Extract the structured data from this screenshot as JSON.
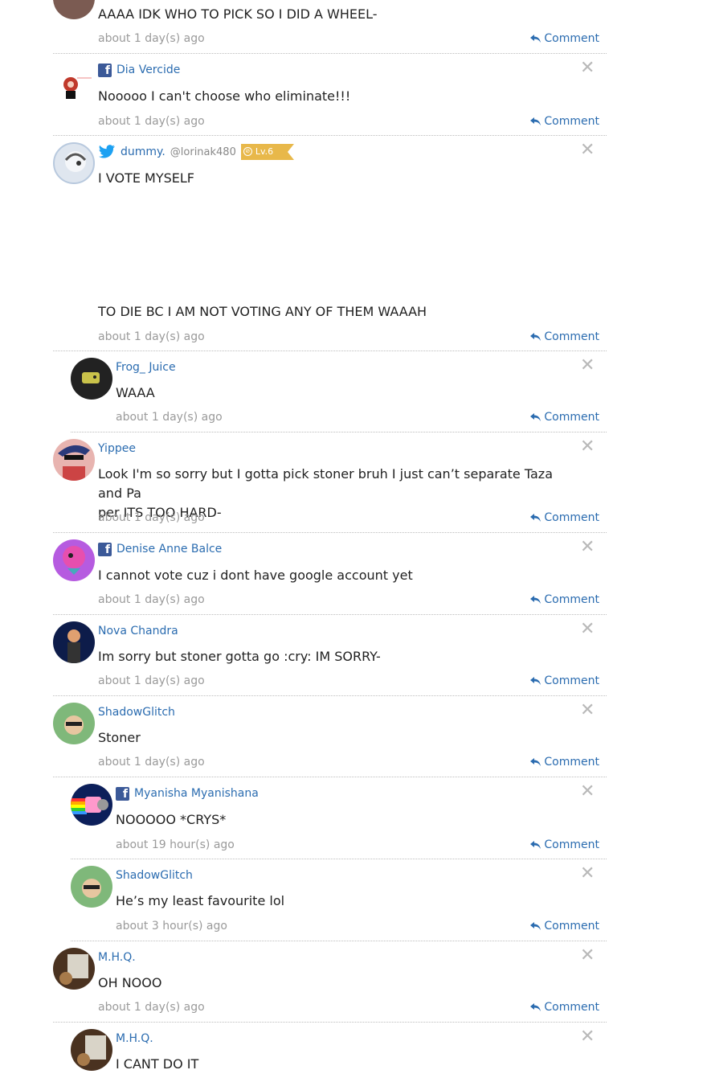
{
  "comment_action_label": "Comment",
  "comments": [
    {
      "author": "",
      "text": "AAAA IDK WHO TO PICK SO I DID A WHEEL-",
      "time": "about 1 day(s) ago"
    },
    {
      "author": "Dia Vercide",
      "source": "facebook",
      "text": "Nooooo I can't choose who eliminate!!!",
      "time": "about 1 day(s) ago"
    },
    {
      "author": "dummy.",
      "source": "twitter",
      "handle": "@lorinak480",
      "level": "Lv.6",
      "text": "I VOTE MYSELF",
      "text_cont": "TO DIE BC I AM NOT VOTING ANY OF THEM WAAAH",
      "time": "about 1 day(s) ago"
    },
    {
      "author": "Frog_ Juice",
      "text": "WAAA",
      "time": "about 1 day(s) ago"
    },
    {
      "author": "Yippee",
      "text": "Look I'm so sorry but I gotta pick stoner bruh I just can’t separate Taza and Pa\nper ITS TOO HARD-",
      "time": "about 1 day(s) ago"
    },
    {
      "author": "Denise Anne Balce",
      "source": "facebook",
      "text": "I cannot vote cuz i dont have google account yet",
      "time": "about 1 day(s) ago"
    },
    {
      "author": "Nova Chandra",
      "text": "Im sorry but stoner gotta go :cry: IM SORRY-",
      "time": "about 1 day(s) ago"
    },
    {
      "author": "ShadowGlitch",
      "text": "Stoner",
      "time": "about 1 day(s) ago"
    },
    {
      "author": "Myanisha Myanishana",
      "source": "facebook",
      "text": "NOOOOO *CRYS*",
      "time": "about 19 hour(s) ago"
    },
    {
      "author": "ShadowGlitch",
      "text": "He’s my least favourite lol",
      "time": "about 3 hour(s) ago"
    },
    {
      "author": "M.H.Q.",
      "text": "OH NOOO",
      "time": "about 1 day(s) ago"
    },
    {
      "author": "M.H.Q.",
      "text": "I CANT DO IT",
      "time": ""
    }
  ],
  "icons": {
    "close": "close-icon",
    "reply": "reply-arrow-icon",
    "facebook": "facebook-icon",
    "twitter": "twitter-icon",
    "level": "level-badge-icon"
  },
  "colors": {
    "link": "#2b6cb0",
    "meta": "#9a9a9a",
    "facebook": "#3b5998",
    "twitter": "#1da1f2",
    "level_badge": "#e8b84a"
  }
}
